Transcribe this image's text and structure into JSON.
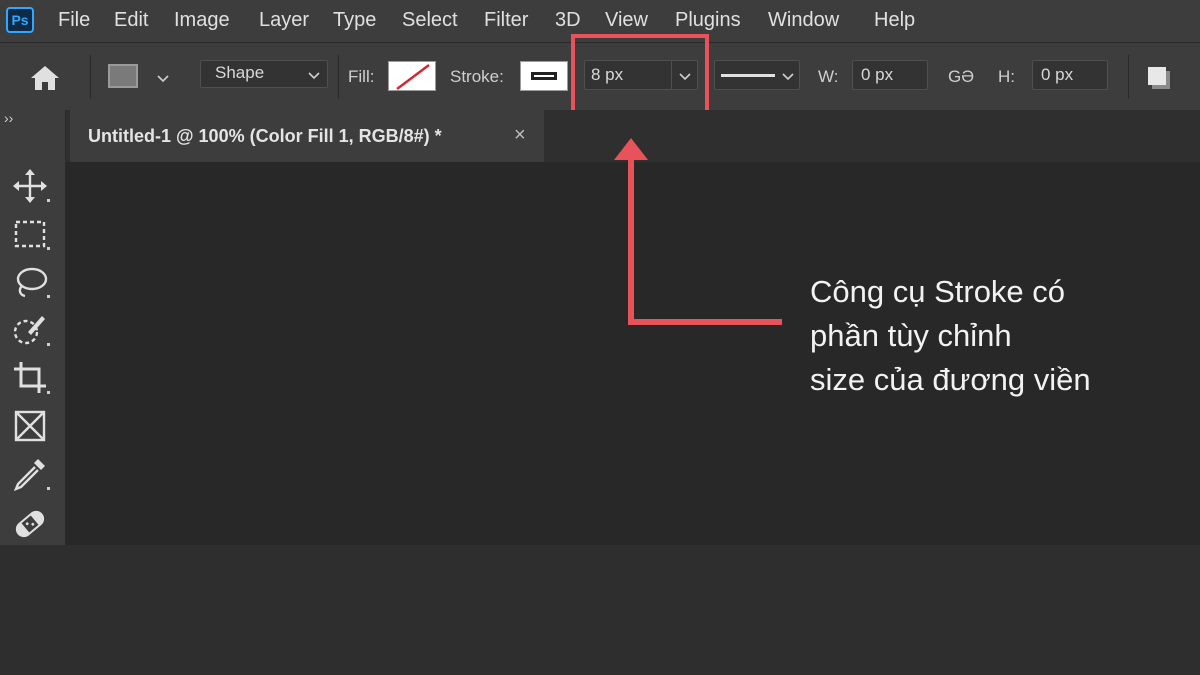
{
  "app": {
    "logo": "Ps"
  },
  "menu": [
    "File",
    "Edit",
    "Image",
    "Layer",
    "Type",
    "Select",
    "Filter",
    "3D",
    "View",
    "Plugins",
    "Window",
    "Help"
  ],
  "options": {
    "mode": "Shape",
    "fill_label": "Fill:",
    "stroke_label": "Stroke:",
    "stroke_width": "8 px",
    "w_label": "W:",
    "w_value": "0 px",
    "link_label": "GƏ",
    "h_label": "H:",
    "h_value": "0 px"
  },
  "left_toggle": "››",
  "document": {
    "tab_title": "Untitled-1 @ 100% (Color Fill 1, RGB/8#) *",
    "close": "×"
  },
  "annotation": {
    "lines": [
      "Công cụ Stroke có",
      "phần tùy chỉnh",
      "size của đương viền"
    ],
    "color": "#e8525a"
  },
  "tools": [
    "move-icon",
    "marquee-icon",
    "lasso-icon",
    "quick-selection-icon",
    "crop-icon",
    "frame-icon",
    "eyedropper-icon",
    "healing-brush-icon"
  ],
  "colors": {
    "accent": "#31a8ff",
    "highlight": "#e8525a",
    "chrome": "#3d3d3d",
    "canvas": "#282828"
  }
}
